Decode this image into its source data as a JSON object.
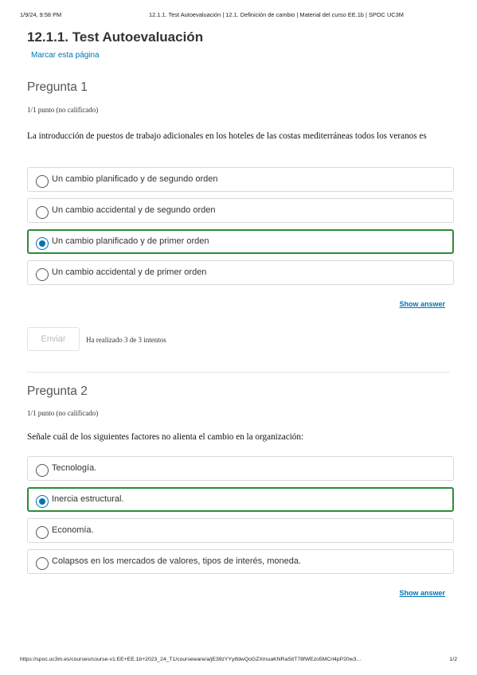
{
  "print_header": {
    "date": "1/9/24, 9:58 PM",
    "title": "12.1.1. Test Autoevaluación | 12.1. Definición de cambio | Material del curso EE.1b | SPOC UC3M"
  },
  "page": {
    "title": "12.1.1. Test Autoevaluación",
    "bookmark": "Marcar esta página"
  },
  "questions": [
    {
      "title": "Pregunta 1",
      "points": "1/1 punto (no calificado)",
      "prompt": "La introducción de puestos de trabajo adicionales en los hoteles de las costas mediterráneas todos los veranos es",
      "options": [
        {
          "label": "Un cambio planificado y de segundo orden",
          "selected": false
        },
        {
          "label": "Un cambio accidental y de segundo orden",
          "selected": false
        },
        {
          "label": "Un cambio planificado y de primer orden",
          "selected": true
        },
        {
          "label": "Un cambio accidental y de primer orden",
          "selected": false
        }
      ],
      "show_answer": "Show answer",
      "submit": "Enviar",
      "attempts": "Ha realizado 3 de 3 intentos"
    },
    {
      "title": "Pregunta 2",
      "points": "1/1 punto (no calificado)",
      "prompt": "Señale cuál de los siguientes factores no alienta el cambio en la organización:",
      "options": [
        {
          "label": "Tecnología.",
          "selected": false
        },
        {
          "label": "Inercia estructural.",
          "selected": true
        },
        {
          "label": "Economía.",
          "selected": false
        },
        {
          "label": "Colapsos en los mercados de valores, tipos de interés, moneda.",
          "selected": false
        }
      ],
      "show_answer": "Show answer"
    }
  ],
  "print_footer": {
    "url": "https://spoc.uc3m.es/courses/course-v1:EE+EE.1b+2023_24_T1/courseware/a/jE39zYYytfdwQoGZXmuaKNRaSitT78fWEzo5MCrl4pP20w3…",
    "page": "1/2"
  },
  "colors": {
    "accent": "#0075b4",
    "selected_border": "#2e8b3a"
  }
}
